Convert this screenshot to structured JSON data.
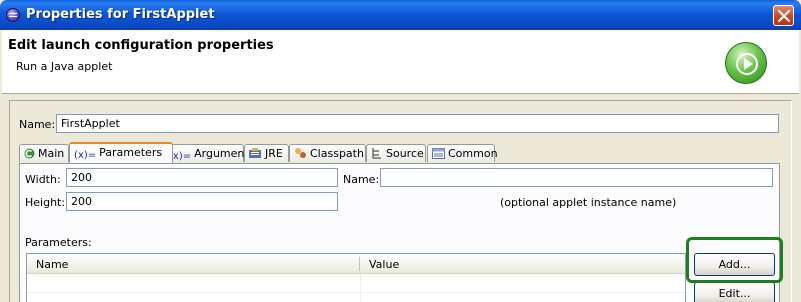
{
  "window": {
    "title": "Properties for FirstApplet"
  },
  "header": {
    "title": "Edit launch configuration properties",
    "subtitle": "Run a Java applet"
  },
  "name_field": {
    "label": "Name:",
    "value": "FirstApplet"
  },
  "tabs": [
    {
      "label": "Main",
      "icon": "main-icon"
    },
    {
      "label": "Parameters",
      "icon": "parameters-icon",
      "active": true
    },
    {
      "label": "Arguments",
      "icon": "arguments-icon"
    },
    {
      "label": "JRE",
      "icon": "jre-icon"
    },
    {
      "label": "Classpath",
      "icon": "classpath-icon"
    },
    {
      "label": "Source",
      "icon": "source-icon"
    },
    {
      "label": "Common",
      "icon": "common-icon"
    }
  ],
  "parameters_tab": {
    "width_label": "Width:",
    "width_value": "200",
    "height_label": "Height:",
    "height_value": "200",
    "name_label": "Name:",
    "name_value": "",
    "name_hint": "(optional applet instance name)",
    "params_label": "Parameters:",
    "table_columns": [
      "Name",
      "Value"
    ],
    "add_button": "Add...",
    "edit_button": "Edit..."
  },
  "colors": {
    "titlebar": "#0a49c4",
    "active_tab_accent": "#e68b2c",
    "highlight_outline": "#1e7d1e"
  }
}
